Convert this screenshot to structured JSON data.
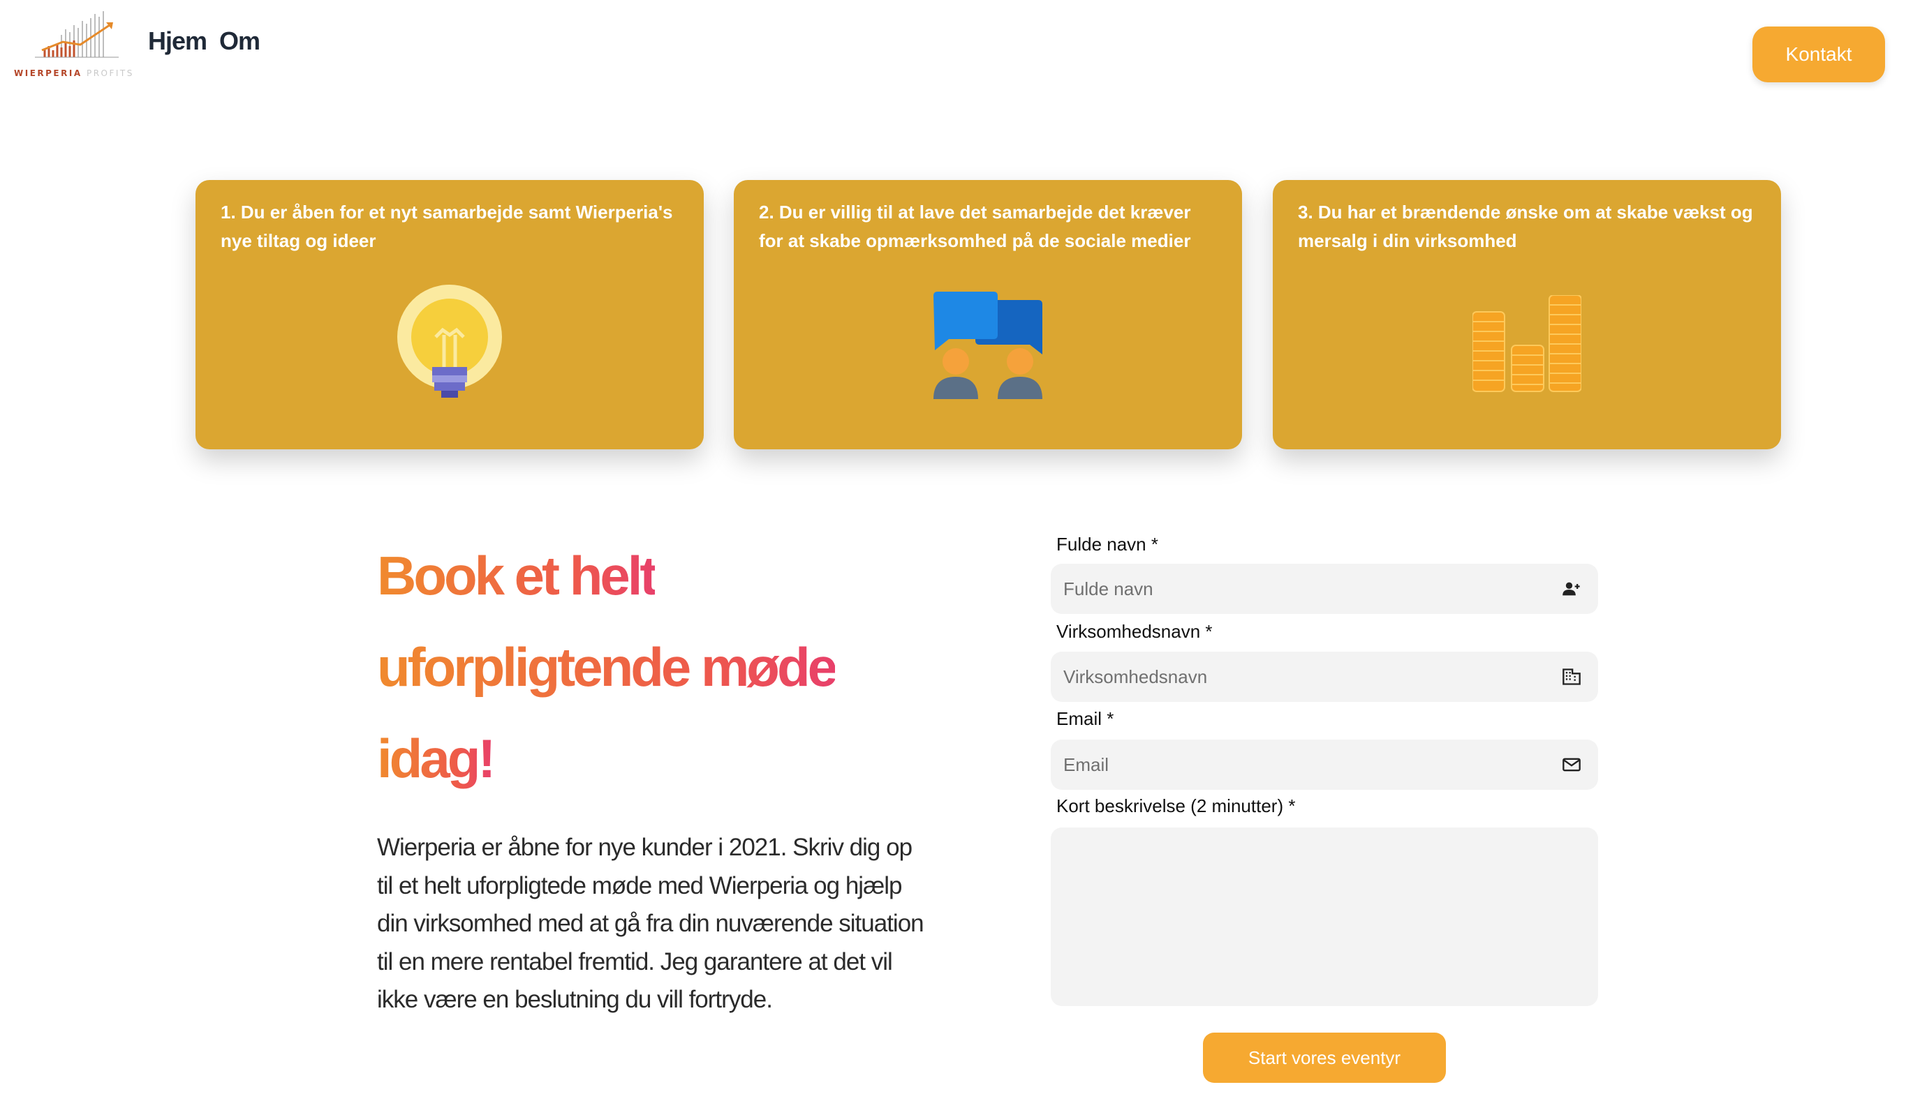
{
  "brand": {
    "logo_word_1": "WIERPERIA",
    "logo_word_2": "PROFITS",
    "accent_color": "#f6a931",
    "card_color": "#dba631"
  },
  "nav": {
    "items": [
      {
        "label": "Hjem"
      },
      {
        "label": "Om"
      }
    ],
    "contact_label": "Kontakt"
  },
  "cards": [
    {
      "text": "1. Du er åben for et nyt samarbejde samt Wierperia's nye tiltag og ideer",
      "icon": "lightbulb-icon"
    },
    {
      "text": "2. Du er villig til at lave det samarbejde det kræver for at skabe opmærksomhed på de sociale medier",
      "icon": "chat-people-icon"
    },
    {
      "text": "3. Du har et brændende ønske om at skabe vækst og mersalg i din virksomhed",
      "icon": "coins-icon"
    }
  ],
  "booking": {
    "heading_lines": [
      "Book et helt",
      "uforpligtende møde",
      "idag!"
    ],
    "description": "Wierperia er åbne for nye kunder i 2021. Skriv dig op til et helt uforpligtede møde med Wierperia og hjælp din virksomhed med at gå fra din nuværende situation til en mere rentabel fremtid. Jeg garantere at det vil ikke være en beslutning du vill fortryde."
  },
  "form": {
    "name": {
      "label": "Fulde navn *",
      "placeholder": "Fulde navn",
      "icon": "user-add-icon"
    },
    "company": {
      "label": "Virksomhedsnavn *",
      "placeholder": "Virksomhedsnavn",
      "icon": "building-icon"
    },
    "email": {
      "label": "Email *",
      "placeholder": "Email",
      "icon": "mail-icon"
    },
    "message": {
      "label": "Kort beskrivelse (2 minutter) *"
    },
    "submit_label": "Start vores eventyr"
  }
}
